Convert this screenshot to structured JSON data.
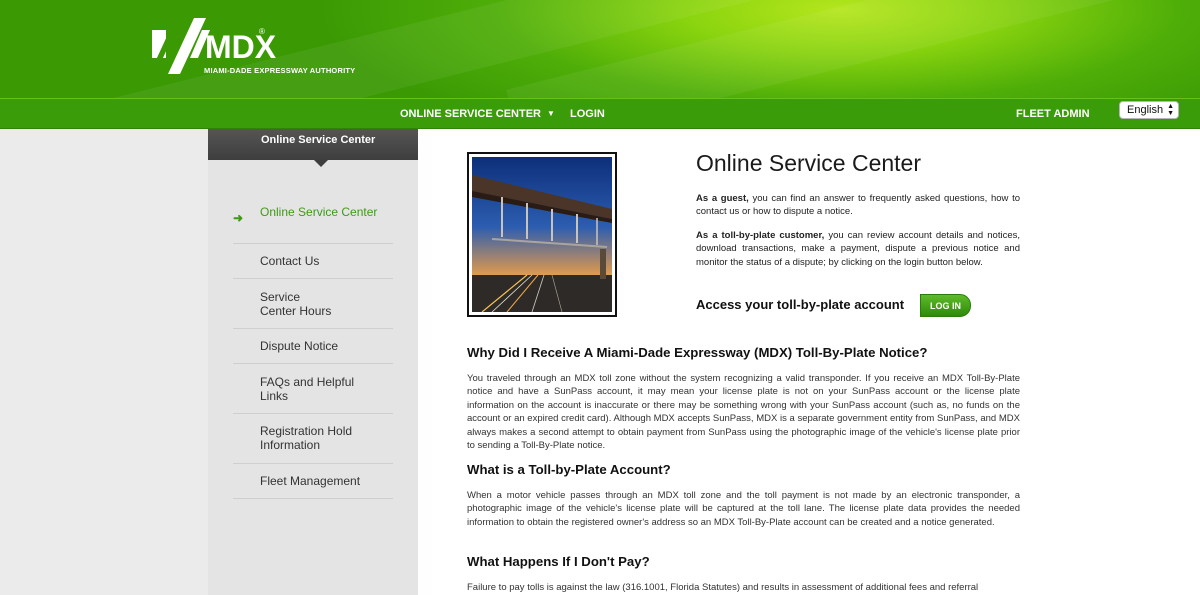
{
  "header": {
    "logo_text": "MDX",
    "logo_subtitle": "MIAMI-DADE EXPRESSWAY AUTHORITY",
    "logo_registered": "®"
  },
  "nav": {
    "online_service_center": "ONLINE SERVICE CENTER",
    "login": "LOGIN",
    "fleet_admin": "FLEET ADMIN",
    "language": "English",
    "language_arrows": "▲▼"
  },
  "sidebar": {
    "tab_title": "Online Service Center",
    "items": [
      {
        "label": "Online Service Center"
      },
      {
        "label": "Contact Us"
      },
      {
        "label": "Service Center Hours"
      },
      {
        "label": "Dispute Notice"
      },
      {
        "label": "FAQs and Helpful Links"
      },
      {
        "label": "Registration Hold Information"
      },
      {
        "label": "Fleet Management"
      }
    ]
  },
  "main": {
    "title": "Online Service Center",
    "guest_bold": "As a guest,",
    "guest_text": " you can find an answer to frequently asked questions, how to contact us or how to dispute a notice.",
    "customer_bold": "As a toll-by-plate customer,",
    "customer_text": " you can review account details and notices, download transactions, make a payment, dispute a previous notice and monitor the status of a dispute; by clicking on the login button below.",
    "access_label": "Access your toll-by-plate account",
    "login_button": "LOG IN",
    "sections": [
      {
        "heading": "Why Did I Receive A Miami-Dade Expressway (MDX) Toll-By-Plate Notice?",
        "text": "You traveled through an MDX toll zone without the system recognizing a valid transponder. If you receive an MDX Toll-By-Plate notice and have a SunPass account, it may mean your license plate is not on your SunPass account or the license plate information on the account is inaccurate or there may be something wrong with your SunPass account (such as, no funds on the account or an expired credit card). Although MDX accepts SunPass, MDX is a separate government entity from SunPass, and MDX always makes a second attempt to obtain payment from SunPass using the photographic image of the vehicle's license plate prior to sending a Toll-By-Plate notice."
      },
      {
        "heading": "What is a Toll-by-Plate Account?",
        "text": "When a motor vehicle passes through an MDX toll zone and the toll payment is not made by an electronic transponder, a photographic image of the vehicle's license plate will be captured at the toll lane. The license plate data provides the needed information to obtain the registered owner's address so an MDX Toll-By-Plate account can be created and a notice generated."
      },
      {
        "heading": "What Happens If I Don't Pay?",
        "text": "Failure to pay tolls is against the law (316.1001, Florida Statutes) and results in assessment of additional fees and referral"
      }
    ]
  },
  "colors": {
    "brand_green": "#3a9c08",
    "accent_green": "#3f9a12",
    "sidebar_tab": "#3e3e3e"
  }
}
